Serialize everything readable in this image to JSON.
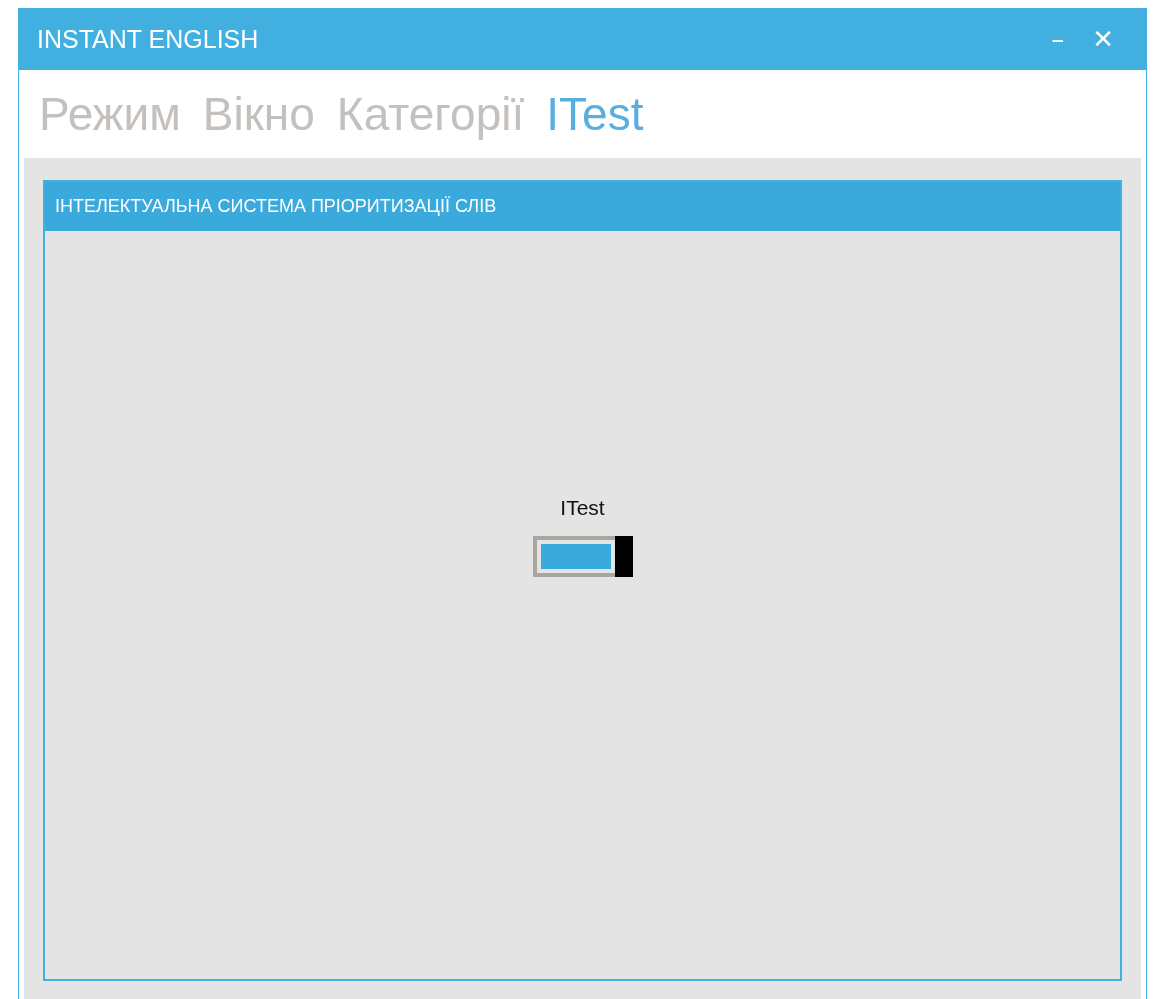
{
  "window": {
    "title": "INSTANT ENGLISH",
    "controls": [
      "–",
      "✕"
    ]
  },
  "menu": [
    {
      "label": "Режим",
      "selected": false
    },
    {
      "label": "Вікно",
      "selected": false
    },
    {
      "label": "Категорії",
      "selected": false
    },
    {
      "label": "ITest",
      "selected": true
    }
  ],
  "panel": {
    "title": "ІНТЕЛЕКТУАЛЬНА СИСТЕМА ПРІОРИТИЗАЦІЇ СЛІВ",
    "toggle": {
      "label": "ITest",
      "on": true
    }
  }
}
